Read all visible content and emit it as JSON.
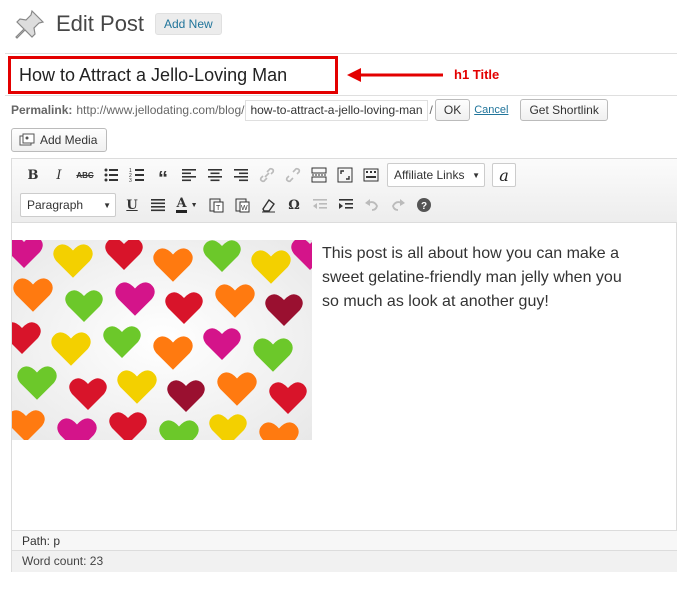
{
  "header": {
    "title": "Edit Post",
    "add_new_label": "Add New"
  },
  "post": {
    "title": "How to Attract a Jello-Loving Man",
    "annotation": "h1 Title",
    "body_text": "This post is all about how you can make a sweet gelatine-friendly man jelly when you so much as look at another guy!"
  },
  "permalink": {
    "label": "Permalink:",
    "base": "http://www.jellodating.com/blog/",
    "slug": "how-to-attract-a-jello-loving-man",
    "separator": "/",
    "ok_label": "OK",
    "cancel_label": "Cancel",
    "shortlink_label": "Get Shortlink"
  },
  "media": {
    "add_media_label": "Add Media"
  },
  "toolbar": {
    "row1": [
      "bold-icon",
      "italic-icon",
      "strikethrough-icon",
      "bullet-list-icon",
      "numbered-list-icon",
      "blockquote-icon",
      "align-left-icon",
      "align-center-icon",
      "align-right-icon",
      "link-icon",
      "unlink-icon",
      "insert-more-icon",
      "fullscreen-icon",
      "kitchen-sink-icon"
    ],
    "affiliate_links_label": "Affiliate Links",
    "paragraph_select": "Paragraph",
    "row2": [
      "underline-icon",
      "justify-icon",
      "text-color-icon",
      "paste-text-icon",
      "paste-word-icon",
      "clear-formatting-icon",
      "special-character-icon",
      "outdent-icon",
      "indent-icon",
      "undo-icon",
      "redo-icon",
      "help-icon"
    ]
  },
  "status": {
    "path_label": "Path: p",
    "word_count_label": "Word count: 23"
  },
  "colors": {
    "annotation_red": "#e30000",
    "link_blue": "#21759b"
  }
}
